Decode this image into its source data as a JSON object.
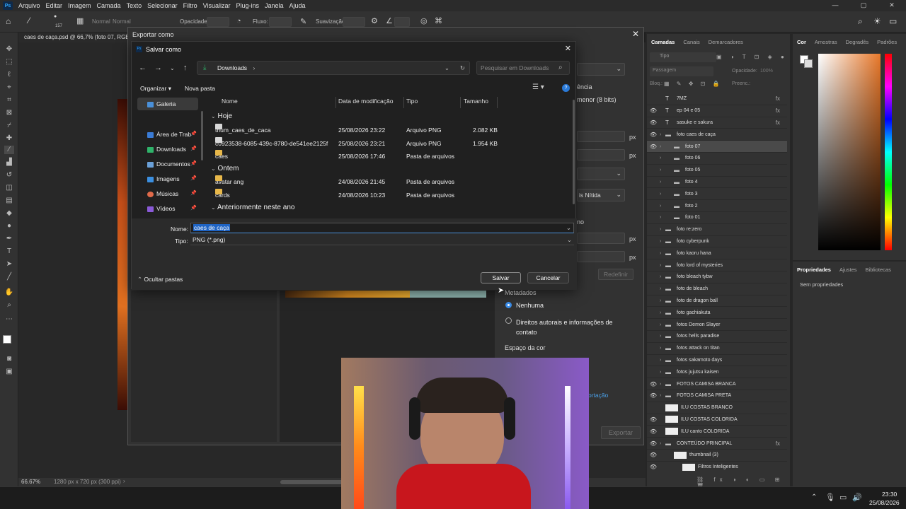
{
  "photoshop": {
    "menu": [
      "Arquivo",
      "Editar",
      "Imagem",
      "Camada",
      "Texto",
      "Selecionar",
      "Filtro",
      "Visualizar",
      "Plug-ins",
      "Janela",
      "Ajuda"
    ],
    "options": {
      "opacity_label": "Opacidade:",
      "flow_label": "Fluxo:",
      "smoothing_label": "Suavização:",
      "brush_size": "157",
      "mode": "Normal"
    },
    "doc_tab": "caes de caça.psd @ 66,7% (foto 07, RGB/8",
    "status_zoom": "66.67%",
    "status_info": "1280 px x 720 px (300 ppi)"
  },
  "layers_panel": {
    "tabs": [
      "Camadas",
      "Canais",
      "Demarcadores"
    ],
    "search_placeholder": "Tipo",
    "blend_label": "Passagem",
    "opacity_label": "Opacidade:",
    "opacity_value": "100%",
    "lock_label": "Bloq.:",
    "fill_label": "Preenc.:",
    "layers": [
      {
        "name": "7MZ",
        "type": "text",
        "fx": "fx",
        "eye": false,
        "indent": 0
      },
      {
        "name": "ep 04 e 05",
        "type": "text",
        "fx": "fx",
        "eye": true,
        "indent": 0
      },
      {
        "name": "sasuke e sakura",
        "type": "text",
        "fx": "fx",
        "eye": true,
        "indent": 0
      },
      {
        "name": "foto caes de caça",
        "type": "group",
        "fx": "",
        "eye": true,
        "indent": 0
      },
      {
        "name": "foto 07",
        "type": "group",
        "fx": "",
        "eye": true,
        "indent": 1,
        "selected": true
      },
      {
        "name": "foto 06",
        "type": "group",
        "fx": "",
        "eye": false,
        "indent": 1
      },
      {
        "name": "foto 05",
        "type": "group",
        "fx": "",
        "eye": false,
        "indent": 1
      },
      {
        "name": "foto 4",
        "type": "group",
        "fx": "",
        "eye": false,
        "indent": 1
      },
      {
        "name": "foto 3",
        "type": "group",
        "fx": "",
        "eye": false,
        "indent": 1
      },
      {
        "name": "foto 2",
        "type": "group",
        "fx": "",
        "eye": false,
        "indent": 1
      },
      {
        "name": "foto 01",
        "type": "group",
        "fx": "",
        "eye": false,
        "indent": 1
      },
      {
        "name": "foto re:zero",
        "type": "group",
        "fx": "",
        "eye": false,
        "indent": 0
      },
      {
        "name": "foto cyberpunk",
        "type": "group",
        "fx": "",
        "eye": false,
        "indent": 0
      },
      {
        "name": "foto kaoru hana",
        "type": "group",
        "fx": "",
        "eye": false,
        "indent": 0
      },
      {
        "name": "foto lord of mysteries",
        "type": "group",
        "fx": "",
        "eye": false,
        "indent": 0
      },
      {
        "name": "foto bleach tybw",
        "type": "group",
        "fx": "",
        "eye": false,
        "indent": 0
      },
      {
        "name": "foto de bleach",
        "type": "group",
        "fx": "",
        "eye": false,
        "indent": 0
      },
      {
        "name": "foto de dragon ball",
        "type": "group",
        "fx": "",
        "eye": false,
        "indent": 0
      },
      {
        "name": "foto gachiakuta",
        "type": "group",
        "fx": "",
        "eye": false,
        "indent": 0
      },
      {
        "name": "fotos Demon Slayer",
        "type": "group",
        "fx": "",
        "eye": false,
        "indent": 0
      },
      {
        "name": "fotos hells paradise",
        "type": "group",
        "fx": "",
        "eye": false,
        "indent": 0
      },
      {
        "name": "fotos attack on titan",
        "type": "group",
        "fx": "",
        "eye": false,
        "indent": 0
      },
      {
        "name": "fotos sakamoto days",
        "type": "group",
        "fx": "",
        "eye": false,
        "indent": 0
      },
      {
        "name": "fotos jujutsu kaisen",
        "type": "group",
        "fx": "",
        "eye": false,
        "indent": 0
      },
      {
        "name": "FOTOS CAMISA BRANCA",
        "type": "group",
        "fx": "",
        "eye": true,
        "indent": 0
      },
      {
        "name": "FOTOS CAMISA PRETA",
        "type": "group",
        "fx": "",
        "eye": true,
        "indent": 0
      },
      {
        "name": "ILU COSTAS BRANCO",
        "type": "thumb",
        "fx": "",
        "eye": false,
        "indent": 0
      },
      {
        "name": "ILU COSTAS COLORIDA",
        "type": "thumb",
        "fx": "",
        "eye": true,
        "indent": 0
      },
      {
        "name": "ILU canto COLORIDA",
        "type": "thumb",
        "fx": "",
        "eye": true,
        "indent": 0
      },
      {
        "name": "CONTEÚDO PRINCIPAL",
        "type": "group",
        "fx": "fx",
        "eye": true,
        "indent": 0
      },
      {
        "name": "thumbnail (3)",
        "type": "thumb",
        "fx": "",
        "eye": true,
        "indent": 1
      },
      {
        "name": "Filtros Inteligentes",
        "type": "thumb",
        "fx": "",
        "eye": true,
        "indent": 2
      }
    ]
  },
  "color_panel": {
    "tabs": [
      "Cor",
      "Amostras",
      "Degradês",
      "Padrões"
    ]
  },
  "props_panel": {
    "tabs": [
      "Propriedades",
      "Ajustes",
      "Bibliotecas"
    ],
    "empty": "Sem propriedades"
  },
  "export_dialog": {
    "title": "Exportar como",
    "partial_1": "ência",
    "partial_2": "menor (8 bits)",
    "partial_3": "is Nítida",
    "partial_4": "no",
    "px": "px",
    "reset": "Redefinir",
    "metadata_label": "Metadados",
    "meta_none": "Nenhuma",
    "meta_copyright": "Direitos autorais e informações de contato",
    "colorspace_label": "Espaço da cor",
    "export_link": "ortação",
    "export_button": "Exportar"
  },
  "save_dialog": {
    "title": "Salvar como",
    "breadcrumb": "Downloads",
    "search_placeholder": "Pesquisar em Downloads",
    "organize": "Organizar",
    "new_folder": "Nova pasta",
    "nav": [
      {
        "label": "Galeria",
        "color": "#4a90d9",
        "pinned": false
      },
      {
        "label": "Área de Trab",
        "color": "#3a7bd5",
        "pinned": true
      },
      {
        "label": "Downloads",
        "color": "#2fb36a",
        "pinned": true
      },
      {
        "label": "Documentos",
        "color": "#6aa0d8",
        "pinned": true
      },
      {
        "label": "Imagens",
        "color": "#3b8fe0",
        "pinned": true
      },
      {
        "label": "Músicas",
        "color": "#e06a4a",
        "pinned": true
      },
      {
        "label": "Vídeos",
        "color": "#8a5ad8",
        "pinned": true
      }
    ],
    "columns": {
      "name": "Nome",
      "date": "Data de modificação",
      "type": "Tipo",
      "size": "Tamanho"
    },
    "groups": {
      "today": "Hoje",
      "yesterday": "Ontem",
      "earlier": "Anteriormente neste ano"
    },
    "files_today": [
      {
        "name": "thum_caes_de_caca",
        "date": "25/08/2026 23:22",
        "type": "Arquivo PNG",
        "size": "2.082 KB",
        "kind": "png"
      },
      {
        "name": "c0923538-6085-439c-8780-de541ee2125f",
        "date": "25/08/2026 23:21",
        "type": "Arquivo PNG",
        "size": "1.954 KB",
        "kind": "png"
      },
      {
        "name": "caes",
        "date": "25/08/2026 17:46",
        "type": "Pasta de arquivos",
        "size": "",
        "kind": "folder"
      }
    ],
    "files_yesterday": [
      {
        "name": "avatar ang",
        "date": "24/08/2026 21:45",
        "type": "Pasta de arquivos",
        "size": "",
        "kind": "folder"
      },
      {
        "name": "cards",
        "date": "24/08/2026 10:23",
        "type": "Pasta de arquivos",
        "size": "",
        "kind": "folder"
      }
    ],
    "filename_label": "Nome:",
    "filename_value": "caes de caça",
    "filetype_label": "Tipo:",
    "filetype_value": "PNG (*.png)",
    "hide_folders": "Ocultar pastas",
    "save_button": "Salvar",
    "cancel_button": "Cancelar"
  },
  "taskbar": {
    "time": "23:30",
    "date": "25/08/2026"
  }
}
